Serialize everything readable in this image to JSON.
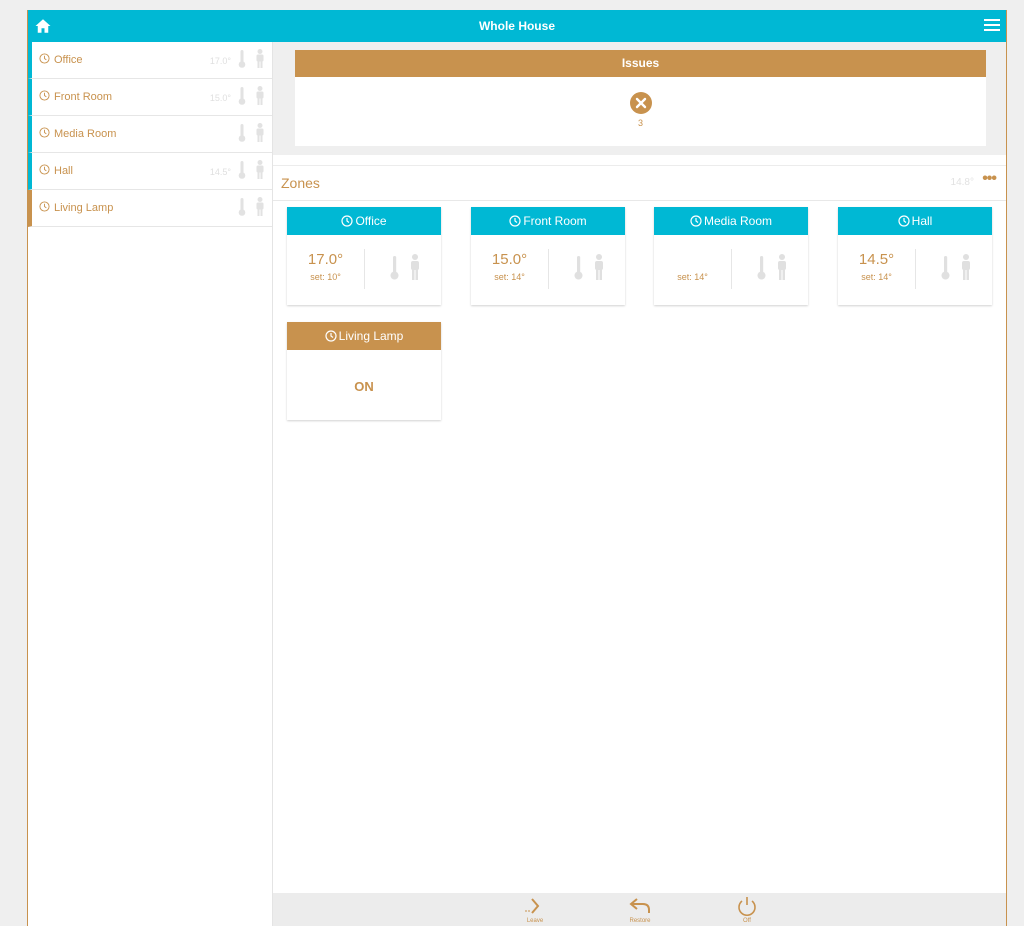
{
  "header": {
    "title": "Whole House",
    "home_icon": "home-icon",
    "menu_icon": "menu-icon",
    "color": "#00b8d4"
  },
  "sidebar": {
    "items": [
      {
        "label": "Office",
        "temp": "17.0°"
      },
      {
        "label": "Front Room",
        "temp": "15.0°"
      },
      {
        "label": "Media Room",
        "temp": ""
      },
      {
        "label": "Hall",
        "temp": "14.5°"
      },
      {
        "label": "Living Lamp",
        "temp": ""
      }
    ]
  },
  "issues": {
    "title": "Issues",
    "count": "3",
    "color": "#c8924e"
  },
  "zones": {
    "title": "Zones",
    "avg_temp": "14.8°",
    "more_label": "•••",
    "cards": [
      {
        "name": "Office",
        "temp": "17.0°",
        "set": "set: 10°"
      },
      {
        "name": "Front Room",
        "temp": "15.0°",
        "set": "set: 14°"
      },
      {
        "name": "Media Room",
        "temp": "",
        "set": "set: 14°"
      },
      {
        "name": "Hall",
        "temp": "14.5°",
        "set": "set: 14°"
      },
      {
        "name": "Living Lamp",
        "state": "ON"
      }
    ]
  },
  "footer": {
    "buttons": [
      {
        "label": "Leave",
        "icon": "chevron-right-icon"
      },
      {
        "label": "Restore",
        "icon": "undo-icon"
      },
      {
        "label": "Off",
        "icon": "power-icon"
      }
    ]
  }
}
